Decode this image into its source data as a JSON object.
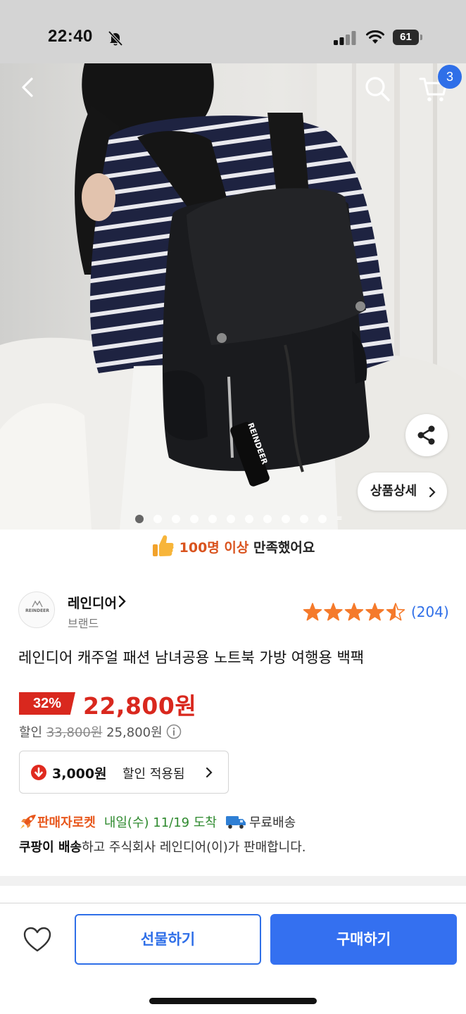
{
  "status_bar": {
    "time": "22:40",
    "battery": "61"
  },
  "nav": {
    "cart_count": "3",
    "icons": [
      "back-icon",
      "search-icon",
      "cart-icon"
    ]
  },
  "hero": {
    "detail_button": "상품상세",
    "image_count": 11,
    "active_index": 0,
    "tag_text": "REINDEER"
  },
  "satisfaction": {
    "highlight": "100명 이상",
    "rest": " 만족했어요"
  },
  "brand": {
    "name": "레인디어",
    "label": "브랜드",
    "logo_text": "REINDEER"
  },
  "rating": {
    "stars": 4.5,
    "review_count": "(204)"
  },
  "product": {
    "title": "레인디어 캐주얼 패션 남녀공용 노트북 가방 여행용 백팩"
  },
  "price": {
    "discount": "32%",
    "sale": "22,800원",
    "discount_label": "할인",
    "original": "33,800원",
    "before_coupon": "25,800원"
  },
  "coupon": {
    "amount": "3,000원",
    "label": "할인 적용됨"
  },
  "delivery": {
    "seller_rocket": "판매자로켓",
    "arrival": "내일(수) 11/19 도착",
    "free_shipping": "무료배송"
  },
  "seller": {
    "bold": "쿠팡이 배송",
    "rest": "하고 주식회사 레인디어(이)가 판매합니다."
  },
  "actions": {
    "gift": "선물하기",
    "buy": "구매하기"
  },
  "colors": {
    "accent_blue": "#2f6fe8",
    "sale_red": "#d9281e",
    "rocket_orange": "#e8571c",
    "arrival_green": "#2f8a2f",
    "star_orange": "#f57a2b"
  }
}
